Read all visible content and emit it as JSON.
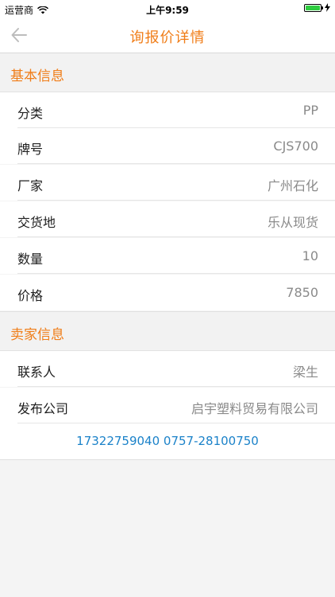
{
  "status_bar": {
    "carrier": "运营商",
    "time": "上午9:59"
  },
  "nav": {
    "title": "询报价详情"
  },
  "basic_info": {
    "title": "基本信息",
    "rows": [
      {
        "label": "分类",
        "value": "PP"
      },
      {
        "label": "牌号",
        "value": "CJS700"
      },
      {
        "label": "厂家",
        "value": "广州石化"
      },
      {
        "label": "交货地",
        "value": "乐从现货"
      },
      {
        "label": "数量",
        "value": "10"
      },
      {
        "label": "价格",
        "value": "7850"
      }
    ]
  },
  "seller_info": {
    "title": "卖家信息",
    "rows": [
      {
        "label": "联系人",
        "value": "梁生"
      },
      {
        "label": "发布公司",
        "value": "启宇塑料贸易有限公司"
      }
    ],
    "contact": "17322759040 0757-28100750"
  },
  "colors": {
    "accent": "#f07d18",
    "link": "#1b82c9"
  }
}
